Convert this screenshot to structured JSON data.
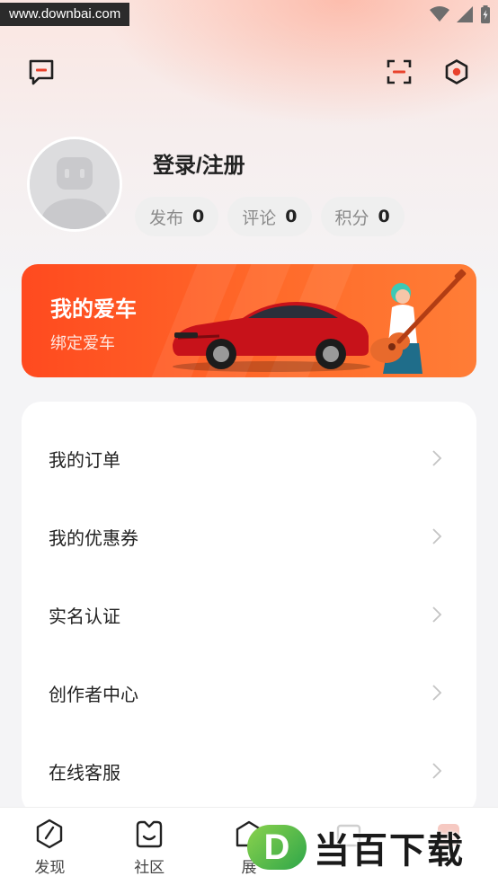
{
  "watermark": "www.downbai.com",
  "profile": {
    "login_label": "登录/注册",
    "stats": [
      {
        "label": "发布",
        "value": "0"
      },
      {
        "label": "评论",
        "value": "0"
      },
      {
        "label": "积分",
        "value": "0"
      }
    ]
  },
  "car_banner": {
    "title": "我的爱车",
    "subtitle": "绑定爱车"
  },
  "menu": [
    {
      "label": "我的订单"
    },
    {
      "label": "我的优惠券"
    },
    {
      "label": "实名认证"
    },
    {
      "label": "创作者中心"
    },
    {
      "label": "在线客服"
    }
  ],
  "tabs": [
    {
      "label": "发现",
      "icon": "discover-icon"
    },
    {
      "label": "社区",
      "icon": "community-icon"
    },
    {
      "label": "展",
      "icon": "showroom-icon"
    },
    {
      "label": "",
      "icon": "mall-icon"
    },
    {
      "label": "",
      "icon": "mine-icon"
    }
  ],
  "brand_watermark": {
    "logo_letter": "D",
    "text": "当百下载"
  },
  "colors": {
    "accent": "#ff4a1f",
    "icon_red": "#e8412c"
  }
}
